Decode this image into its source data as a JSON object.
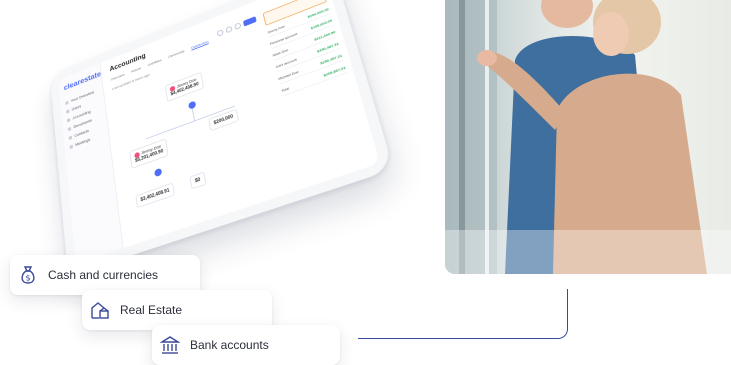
{
  "app": {
    "logo_prefix": "clear",
    "logo_suffix": "estate",
    "title": "Accounting",
    "tabs": [
      "Overview",
      "Assets",
      "Liabilities",
      "Ownership",
      "Distribution"
    ],
    "active_tab": 4,
    "note": "Last updated 8 hours ago",
    "sidebar": [
      "Your Overview",
      "Users",
      "Accounting",
      "Documents",
      "Contacts",
      "Meetings"
    ],
    "nodes": [
      {
        "name": "Jimmy Doe",
        "value": "$4,402,408.90"
      },
      {
        "name": "Jimmy Doe",
        "value": "$5,201,400.90"
      },
      {
        "name": "",
        "value": "$200,000"
      },
      {
        "name": "",
        "value": "$3,402,408.91"
      },
      {
        "name": "",
        "value": "$0"
      }
    ],
    "panel_rows": [
      {
        "label": "Jimmy Doe",
        "amount": "$200,000.00"
      },
      {
        "label": "Personal account",
        "amount": "$195,604.00"
      },
      {
        "label": "Mark Doe",
        "amount": "$111,400.50"
      },
      {
        "label": "Joint account",
        "amount": "$340,487.31"
      },
      {
        "label": "Michael Doe",
        "amount": "$250,457.31"
      },
      {
        "label": "Total",
        "amount": "$265,867.01"
      }
    ]
  },
  "cards": {
    "cash": "Cash and currencies",
    "real_estate": "Real Estate",
    "bank": "Bank accounts"
  },
  "colors": {
    "accent": "#4f6ef7",
    "connector": "#3a4a9a",
    "icon": "#3a4a9a"
  }
}
